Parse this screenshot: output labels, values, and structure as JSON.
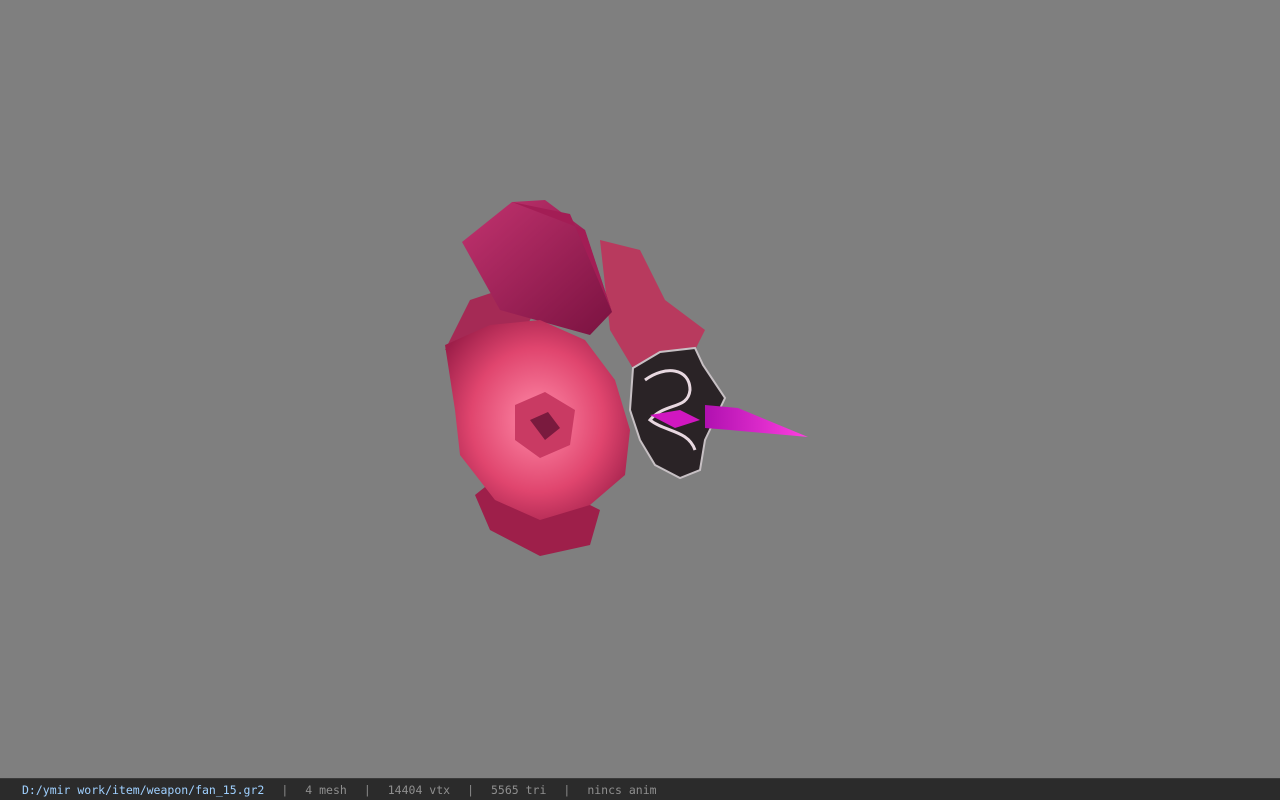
{
  "viewer": {
    "model_icon": "fan-model-icon",
    "colors": {
      "background": "#7f7f7f",
      "statusbar": "#2b2b2b",
      "path": "#9fd0ff",
      "petal_dark": "#8e1c4a",
      "petal_light": "#f06a8e",
      "blade": "#e020d0"
    }
  },
  "status": {
    "path": "D:/ymir work/item/weapon/fan_15.gr2",
    "sep": "|",
    "mesh": "4 mesh",
    "vtx": "14404 vtx",
    "tri": "5565 tri",
    "anim": "nincs anim"
  }
}
